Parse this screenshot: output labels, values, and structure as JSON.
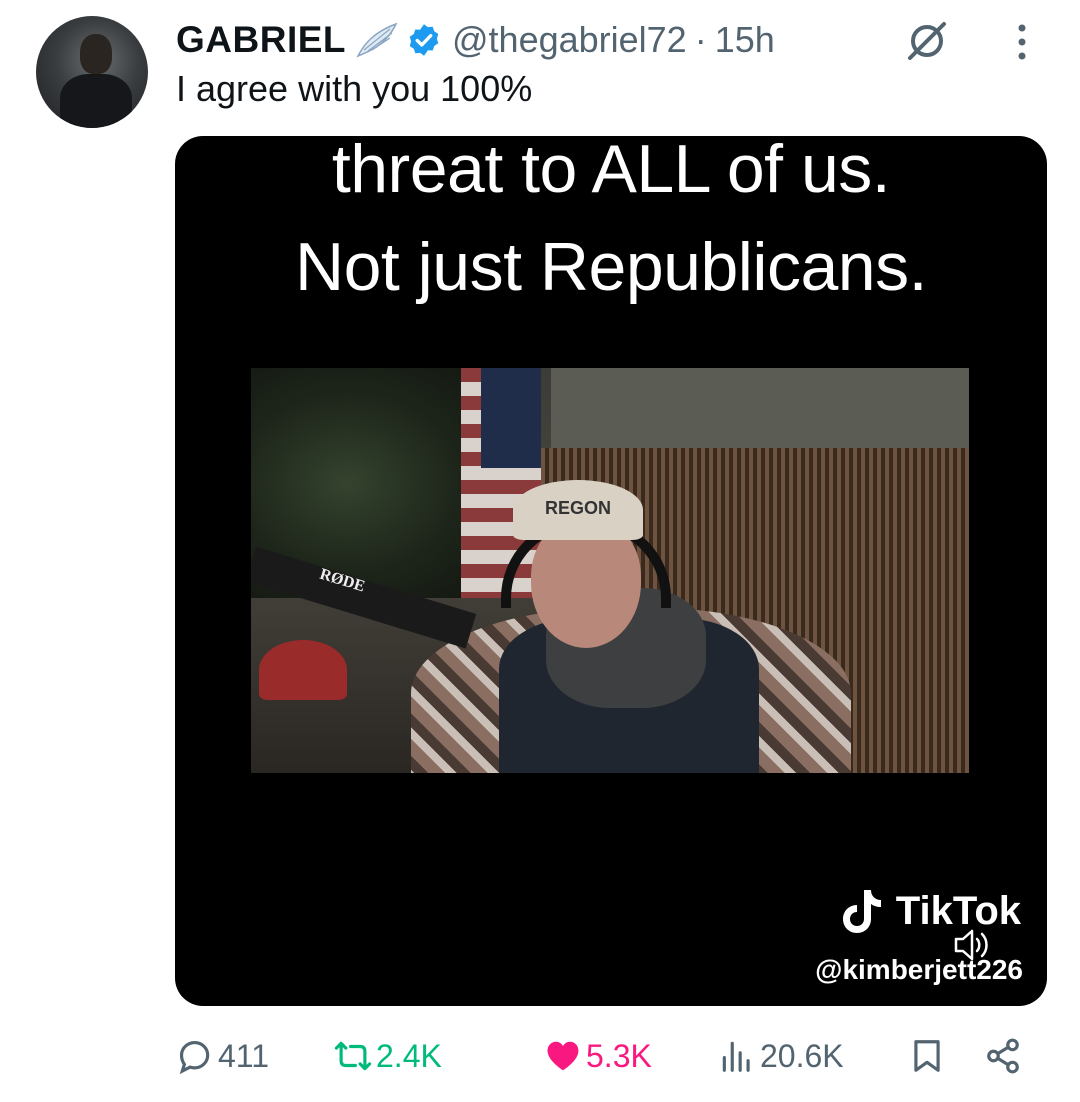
{
  "tweet": {
    "display_name": "GABRIEL",
    "handle": "@thegabriel72",
    "separator": "·",
    "time": "15h",
    "text": "I agree with you 100%",
    "verified": true
  },
  "media": {
    "caption_line1": "threat to ALL of us.",
    "caption_line2": "Not just Republicans.",
    "mic_brand": "RØDE",
    "cap_text": "REGON",
    "watermark_brand": "TikTok",
    "watermark_handle": "@kimberjett226"
  },
  "actions": {
    "replies": "411",
    "retweets": "2.4K",
    "likes": "5.3K",
    "views": "20.6K"
  },
  "colors": {
    "verified": "#1d9bf0",
    "retweet": "#00ba7c",
    "like": "#f91880",
    "muted": "#536471"
  },
  "icons": [
    "wing-emoji-icon",
    "verified-badge-icon",
    "grok-icon",
    "more-icon",
    "tiktok-logo-icon",
    "speaker-icon",
    "reply-icon",
    "retweet-icon",
    "like-icon",
    "views-icon",
    "bookmark-icon",
    "share-icon"
  ]
}
